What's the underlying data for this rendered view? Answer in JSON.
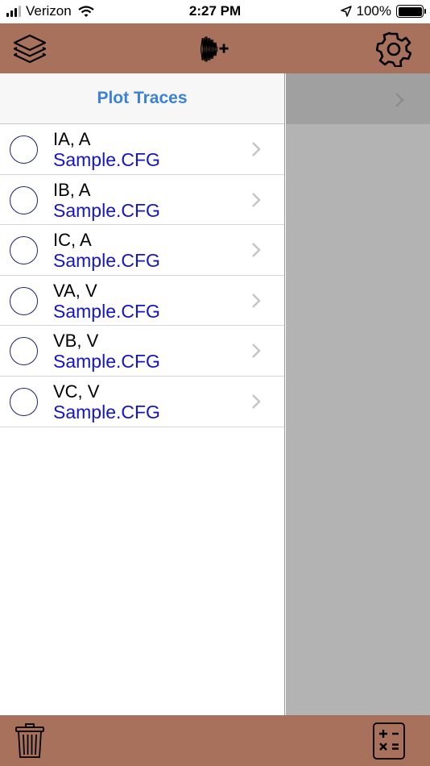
{
  "status_bar": {
    "carrier": "Verizon",
    "time": "2:27 PM",
    "battery": "100%"
  },
  "toolbar": {
    "left_icon": "layers-icon",
    "center_icon": "add-waveform-icon",
    "right_icon": "gear-icon"
  },
  "master": {
    "title": "Plot Traces",
    "traces": [
      {
        "name": "IA, A",
        "file": "Sample.CFG"
      },
      {
        "name": "IB, A",
        "file": "Sample.CFG"
      },
      {
        "name": "IC, A",
        "file": "Sample.CFG"
      },
      {
        "name": "VA, V",
        "file": "Sample.CFG"
      },
      {
        "name": "VB, V",
        "file": "Sample.CFG"
      },
      {
        "name": "VC, V",
        "file": "Sample.CFG"
      }
    ]
  },
  "bottom_bar": {
    "left_icon": "trash-icon",
    "right_icon": "calculator-icon"
  },
  "colors": {
    "toolbar": "#a7715c",
    "title_blue": "#3b82d6",
    "file_blue": "#1414c8",
    "detail_gray": "#b3b3b3"
  }
}
